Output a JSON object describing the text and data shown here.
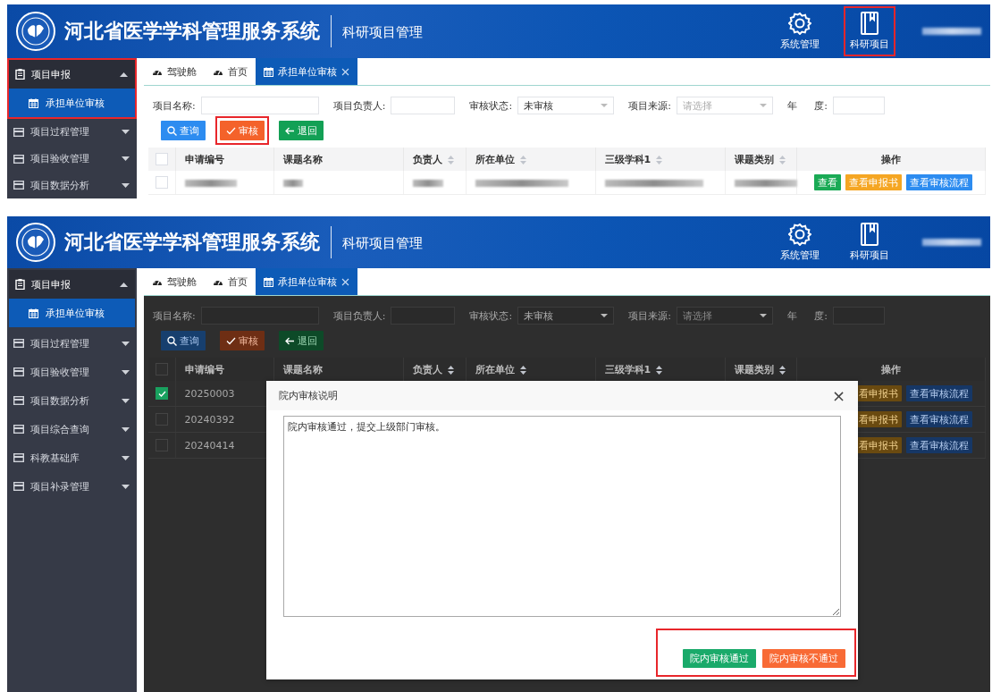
{
  "panels": [
    {
      "header": {
        "title": "河北省医学学科管理服务系统",
        "subtitle": "科研项目管理",
        "nav": [
          {
            "label": "系统管理",
            "kind": "settings",
            "highlighted": false
          },
          {
            "label": "科研项目",
            "kind": "book",
            "highlighted": true
          }
        ]
      },
      "sidebar": {
        "highlighted": true,
        "items": [
          {
            "label": "项目申报",
            "kind": "report",
            "expanded": true,
            "children": [
              {
                "label": "承担单位审核",
                "selected": true
              }
            ]
          },
          {
            "label": "项目过程管理",
            "kind": "module",
            "expanded": false
          },
          {
            "label": "项目验收管理",
            "kind": "module",
            "expanded": false
          },
          {
            "label": "项目数据分析",
            "kind": "module",
            "expanded": false
          }
        ]
      },
      "tabs": [
        {
          "label": "驾驶舱",
          "kind": "dashboard",
          "selected": false,
          "closable": false
        },
        {
          "label": "首页",
          "kind": "dashboard",
          "selected": false,
          "closable": false
        },
        {
          "label": "承担单位审核",
          "kind": "page",
          "selected": true,
          "closable": true
        }
      ],
      "filters": [
        {
          "label": "项目名称:",
          "kind": "text"
        },
        {
          "label": "项目负责人:",
          "kind": "text"
        },
        {
          "label": "审核状态:",
          "kind": "select",
          "value": "未审核"
        },
        {
          "label": "项目来源:",
          "kind": "select",
          "placeholder": "请选择"
        },
        {
          "label": "年 度:",
          "kind": "text"
        }
      ],
      "buttons": [
        {
          "label": "查询",
          "kind": "search",
          "highlighted": false
        },
        {
          "label": "审核",
          "kind": "audit",
          "highlighted": true
        },
        {
          "label": "退回",
          "kind": "return",
          "highlighted": false
        }
      ],
      "table": {
        "all_checked": false,
        "columns": [
          {
            "label": "申请编号",
            "sortable": false
          },
          {
            "label": "课题名称",
            "sortable": false
          },
          {
            "label": "负责人",
            "sortable": true
          },
          {
            "label": "所在单位",
            "sortable": true
          },
          {
            "label": "三级学科1",
            "sortable": true
          },
          {
            "label": "课题类别",
            "sortable": true
          },
          {
            "label": "操作",
            "sortable": false
          }
        ],
        "rows": [
          {
            "checked": false,
            "blurred": true,
            "actions": [
              {
                "label": "查看",
                "kind": "view"
              },
              {
                "label": "查看申报书",
                "kind": "report"
              },
              {
                "label": "查看审核流程",
                "kind": "flow"
              }
            ]
          }
        ]
      }
    },
    {
      "header": {
        "title": "河北省医学学科管理服务系统",
        "subtitle": "科研项目管理",
        "nav": [
          {
            "label": "系统管理",
            "kind": "settings",
            "highlighted": false
          },
          {
            "label": "科研项目",
            "kind": "book",
            "highlighted": false
          }
        ]
      },
      "sidebar": {
        "highlighted": false,
        "items": [
          {
            "label": "项目申报",
            "kind": "report",
            "expanded": true,
            "children": [
              {
                "label": "承担单位审核",
                "selected": true
              }
            ]
          },
          {
            "label": "项目过程管理",
            "kind": "module",
            "expanded": false
          },
          {
            "label": "项目验收管理",
            "kind": "module",
            "expanded": false
          },
          {
            "label": "项目数据分析",
            "kind": "module",
            "expanded": false
          },
          {
            "label": "项目综合查询",
            "kind": "module",
            "expanded": false
          },
          {
            "label": "科教基础库",
            "kind": "module",
            "expanded": false
          },
          {
            "label": "项目补录管理",
            "kind": "module",
            "expanded": false
          }
        ]
      },
      "tabs": [
        {
          "label": "驾驶舱",
          "kind": "dashboard",
          "selected": false,
          "closable": false
        },
        {
          "label": "首页",
          "kind": "dashboard",
          "selected": false,
          "closable": false
        },
        {
          "label": "承担单位审核",
          "kind": "page",
          "selected": true,
          "closable": true
        }
      ],
      "filters": [
        {
          "label": "项目名称:",
          "kind": "text"
        },
        {
          "label": "项目负责人:",
          "kind": "text"
        },
        {
          "label": "审核状态:",
          "kind": "select",
          "value": "未审核"
        },
        {
          "label": "项目来源:",
          "kind": "select",
          "placeholder": "请选择"
        },
        {
          "label": "年 度:",
          "kind": "text"
        }
      ],
      "buttons": [
        {
          "label": "查询",
          "kind": "search",
          "highlighted": false
        },
        {
          "label": "审核",
          "kind": "audit",
          "highlighted": false
        },
        {
          "label": "退回",
          "kind": "return",
          "highlighted": false
        }
      ],
      "table": {
        "all_checked": false,
        "columns": [
          {
            "label": "申请编号",
            "sortable": false
          },
          {
            "label": "课题名称",
            "sortable": false
          },
          {
            "label": "负责人",
            "sortable": true
          },
          {
            "label": "所在单位",
            "sortable": true
          },
          {
            "label": "三级学科1",
            "sortable": true
          },
          {
            "label": "课题类别",
            "sortable": true
          },
          {
            "label": "操作",
            "sortable": false
          }
        ],
        "rows": [
          {
            "checked": true,
            "cells": [
              "20250003"
            ],
            "actions": [
              {
                "label": "看申报书",
                "kind": "report"
              },
              {
                "label": "查看审核流程",
                "kind": "flow"
              }
            ]
          },
          {
            "checked": false,
            "cells": [
              "20240392"
            ],
            "actions": [
              {
                "label": "看申报书",
                "kind": "report"
              },
              {
                "label": "查看审核流程",
                "kind": "flow"
              }
            ]
          },
          {
            "checked": false,
            "cells": [
              "20240414"
            ],
            "actions": [
              {
                "label": "看申报书",
                "kind": "report"
              },
              {
                "label": "查看审核流程",
                "kind": "flow"
              }
            ]
          }
        ]
      },
      "dialog": {
        "title": "院内审核说明",
        "close": "×",
        "value": "院内审核通过，提交上级部门审核。",
        "footer_highlighted": true,
        "buttons": [
          {
            "label": "院内审核通过",
            "kind": "approve"
          },
          {
            "label": "院内审核不通过",
            "kind": "reject"
          }
        ]
      }
    }
  ]
}
